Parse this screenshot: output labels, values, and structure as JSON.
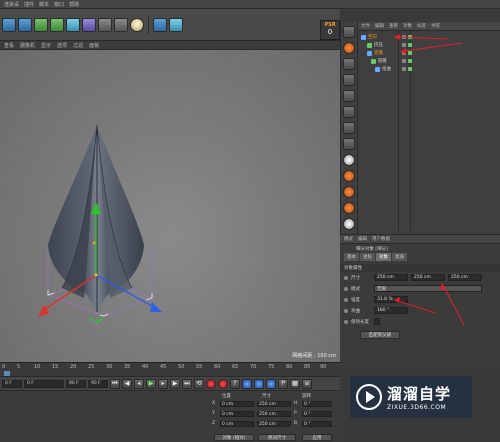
{
  "menubar": {
    "items": [
      "渲染设",
      "插件",
      "脚本",
      "窗口",
      "帮助"
    ]
  },
  "toolbar": {
    "icons": [
      "cube-icon",
      "pen-icon",
      "spline-icon",
      "subdivide-icon",
      "array-icon",
      "grid-icon",
      "camera-icon",
      "light-icon",
      "sky-icon",
      "tag-icon"
    ]
  },
  "viewport": {
    "menu": [
      "查看",
      "摄像机",
      "显示",
      "选项",
      "过滤",
      "面板"
    ],
    "grid_label": "网格间距 : 100 cm"
  },
  "psr": {
    "title": "PSR",
    "value": "0"
  },
  "object_manager": {
    "menu": [
      "文件",
      "编辑",
      "查看",
      "对象",
      "标签",
      "书签"
    ],
    "rows": [
      {
        "name": "空白",
        "highlight": true,
        "indent": 0
      },
      {
        "name": "挤压",
        "highlight": false,
        "indent": 6
      },
      {
        "name": "克隆",
        "highlight": true,
        "indent": 6
      },
      {
        "name": "圆锥",
        "highlight": false,
        "indent": 10
      },
      {
        "name": "扭曲",
        "highlight": false,
        "indent": 14
      }
    ]
  },
  "attributes": {
    "menu": [
      "模式",
      "编辑",
      "用户数据"
    ],
    "title": "细分对象 [细分]",
    "tabs": [
      {
        "label": "基本",
        "active": false
      },
      {
        "label": "坐标",
        "active": false
      },
      {
        "label": "对象",
        "active": true
      },
      {
        "label": "衰减",
        "active": false
      }
    ],
    "section": "对象属性",
    "rows": {
      "size": {
        "label": "尺寸",
        "x": "250 cm",
        "y": "250 cm",
        "z": "250 cm"
      },
      "mode": {
        "label": "模式",
        "value": "无限"
      },
      "strength": {
        "label": "强度",
        "value": "31.8 %"
      },
      "angle": {
        "label": "弯曲",
        "value": "180 °"
      },
      "keep": {
        "label": "保持长度"
      }
    },
    "button": "匹配到父级"
  },
  "timeline": {
    "ticks": [
      "0",
      "5",
      "10",
      "15",
      "20",
      "25",
      "30",
      "35",
      "40",
      "45",
      "50",
      "55",
      "60",
      "65",
      "70",
      "75",
      "80",
      "85",
      "90"
    ],
    "fps": "0 F"
  },
  "playbar": {
    "start": "0 F",
    "frame": "0 F",
    "end": "90 F",
    "end2": "90 F"
  },
  "coordinates": {
    "headers": {
      "pos": "位置",
      "size": "尺寸",
      "rot": "旋转"
    },
    "rows": [
      {
        "axis": "X",
        "pos": "0 cm",
        "size": "250 cm",
        "raxis": "H",
        "rot": "0 °"
      },
      {
        "axis": "Y",
        "pos": "0 cm",
        "size": "250 cm",
        "raxis": "P",
        "rot": "0 °"
      },
      {
        "axis": "Z",
        "pos": "0 cm",
        "size": "250 cm",
        "raxis": "B",
        "rot": "0 °"
      }
    ],
    "mode1": "对象 (相对)",
    "mode2": "绝对尺寸",
    "apply": "应用"
  },
  "brand": {
    "name": "溜溜自学",
    "url": "ZIXUE.3D66.COM"
  },
  "colors": {
    "accent": "#f0a020",
    "annotation": "#e0202a",
    "axis_x": "#e03030",
    "axis_y": "#30c030",
    "axis_z": "#3060e0"
  }
}
